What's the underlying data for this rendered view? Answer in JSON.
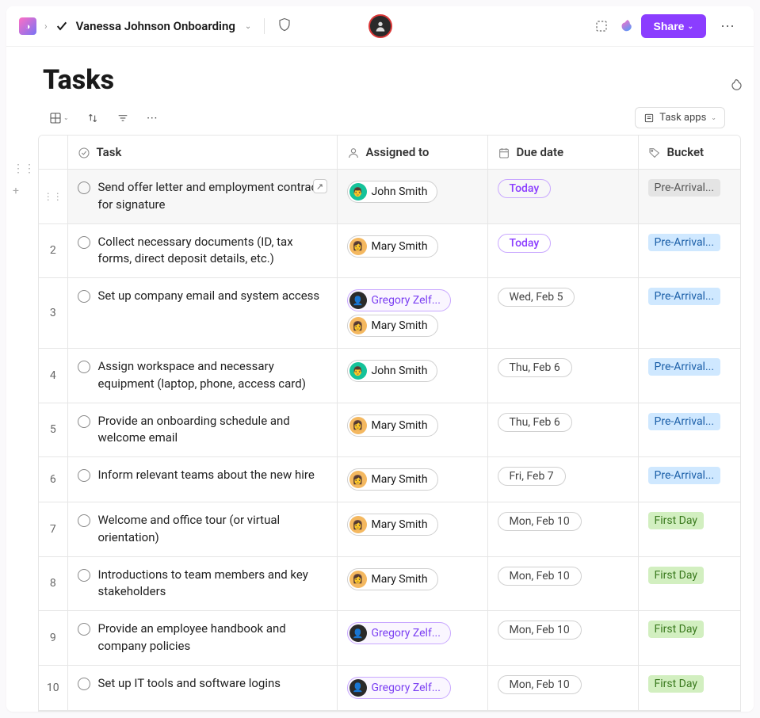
{
  "header": {
    "breadcrumb_title": "Vanessa Johnson Onboarding",
    "share_label": "Share"
  },
  "page": {
    "title": "Tasks",
    "task_apps_label": "Task apps"
  },
  "columns": {
    "task": "Task",
    "assigned": "Assigned to",
    "due": "Due date",
    "bucket": "Bucket"
  },
  "people": {
    "john": "John Smith",
    "mary": "Mary Smith",
    "greg": "Gregory Zelf..."
  },
  "buckets": {
    "pre": "Pre-Arrival...",
    "first": "First Day"
  },
  "rows": [
    {
      "num": "",
      "task": "Send offer letter and employment contract for signature",
      "assignees": [
        "john"
      ],
      "due": "Today",
      "due_style": "today",
      "bucket": "pre",
      "bucket_style": "pre-gray",
      "selected": true
    },
    {
      "num": "2",
      "task": "Collect necessary documents (ID, tax forms, direct deposit details, etc.)",
      "assignees": [
        "mary"
      ],
      "due": "Today",
      "due_style": "today",
      "bucket": "pre",
      "bucket_style": "pre"
    },
    {
      "num": "3",
      "task": "Set up company email and system access",
      "assignees": [
        "greg",
        "mary"
      ],
      "due": "Wed, Feb 5",
      "due_style": "",
      "bucket": "pre",
      "bucket_style": "pre"
    },
    {
      "num": "4",
      "task": "Assign workspace and necessary equipment (laptop, phone, access card)",
      "assignees": [
        "john"
      ],
      "due": "Thu, Feb 6",
      "due_style": "",
      "bucket": "pre",
      "bucket_style": "pre"
    },
    {
      "num": "5",
      "task": "Provide an onboarding schedule and welcome email",
      "assignees": [
        "mary"
      ],
      "due": "Thu, Feb 6",
      "due_style": "",
      "bucket": "pre",
      "bucket_style": "pre"
    },
    {
      "num": "6",
      "task": "Inform relevant teams about the new hire",
      "assignees": [
        "mary"
      ],
      "due": "Fri, Feb 7",
      "due_style": "",
      "bucket": "pre",
      "bucket_style": "pre"
    },
    {
      "num": "7",
      "task": "Welcome and office tour (or virtual orientation)",
      "assignees": [
        "mary"
      ],
      "due": "Mon, Feb 10",
      "due_style": "",
      "bucket": "first",
      "bucket_style": "first"
    },
    {
      "num": "8",
      "task": "Introductions to team members and key stakeholders",
      "assignees": [
        "mary"
      ],
      "due": "Mon, Feb 10",
      "due_style": "",
      "bucket": "first",
      "bucket_style": "first"
    },
    {
      "num": "9",
      "task": "Provide an employee handbook and company policies",
      "assignees": [
        "greg"
      ],
      "due": "Mon, Feb 10",
      "due_style": "",
      "bucket": "first",
      "bucket_style": "first"
    },
    {
      "num": "10",
      "task": "Set up IT tools and software logins",
      "assignees": [
        "greg"
      ],
      "due": "Mon, Feb 10",
      "due_style": "",
      "bucket": "first",
      "bucket_style": "first"
    }
  ]
}
